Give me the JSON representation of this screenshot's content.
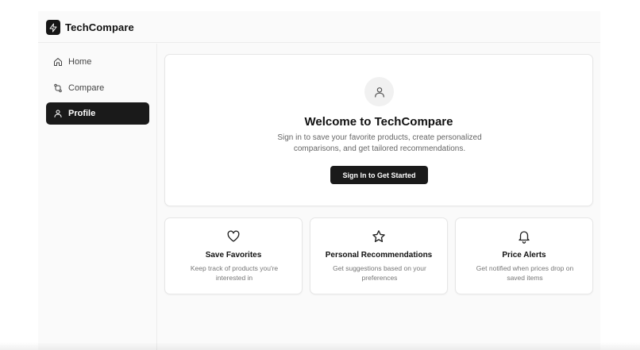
{
  "app": {
    "brand": "TechCompare",
    "logo_icon": "bolt-icon"
  },
  "sidebar": {
    "items": [
      {
        "label": "Home",
        "icon": "home-icon",
        "active": false
      },
      {
        "label": "Compare",
        "icon": "compare-icon",
        "active": false
      },
      {
        "label": "Profile",
        "icon": "user-icon",
        "active": true
      }
    ]
  },
  "hero": {
    "icon": "user-icon",
    "title": "Welcome to TechCompare",
    "description": "Sign in to save your favorite products, create personalized comparisons, and get tailored recommendations.",
    "cta_label": "Sign In to Get Started"
  },
  "features": [
    {
      "icon": "heart-icon",
      "title": "Save Favorites",
      "description": "Keep track of products you're interested in"
    },
    {
      "icon": "star-icon",
      "title": "Personal Recommendations",
      "description": "Get suggestions based on your preferences"
    },
    {
      "icon": "bell-icon",
      "title": "Price Alerts",
      "description": "Get notified when prices drop on saved items"
    }
  ],
  "colors": {
    "accent": "#1a1a1a",
    "background": "#fafafa",
    "card": "#ffffff",
    "border": "#e6e6e6"
  }
}
